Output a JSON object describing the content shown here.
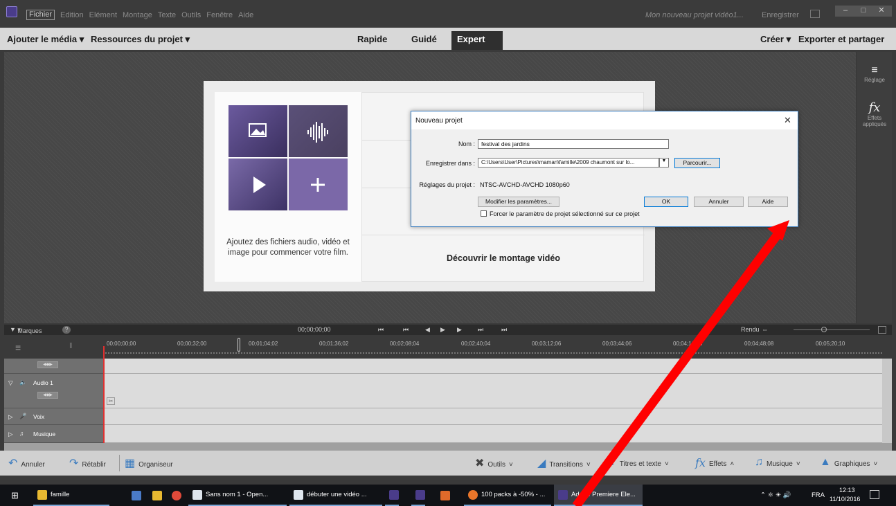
{
  "titlebar": {
    "menus": [
      "Fichier",
      "Edition",
      "Elément",
      "Montage",
      "Texte",
      "Outils",
      "Fenêtre",
      "Aide"
    ],
    "project_title": "Mon nouveau projet vidéo1...",
    "save_label": "Enregistrer",
    "win_min": "‒",
    "win_max": "□",
    "win_close": "✕"
  },
  "modebar": {
    "add_media": "Ajouter le média ▾",
    "project_resources": "Ressources du projet ▾",
    "tab_quick": "Rapide",
    "tab_guided": "Guidé",
    "tab_expert": "Expert",
    "create": "Créer ▾",
    "export_share": "Exporter et partager"
  },
  "rightpanel": {
    "adjust_label": "Réglage",
    "fx_label": "Effets appliqués"
  },
  "welcome": {
    "intro_text": "Ajoutez des fichiers audio, vidéo et image pour commencer votre film.",
    "discover": "Découvrir le montage vidéo"
  },
  "dialog": {
    "title": "Nouveau projet",
    "close": "✕",
    "name_label": "Nom :",
    "name_value": "festival des jardins",
    "save_in_label": "Enregistrer dans :",
    "save_in_value": "C:\\Users\\User\\Pictures\\maman\\famille\\2009 chaumont sur lo...",
    "browse": "Parcourir...",
    "settings_label": "Réglages du projet :",
    "settings_value": "NTSC-AVCHD-AVCHD 1080p60",
    "modify": "Modifier les paramètres...",
    "ok": "OK",
    "cancel": "Annuler",
    "help": "Aide",
    "force_label": "Forcer le paramètre de projet sélectionné sur ce projet"
  },
  "timeline": {
    "markers": "Marques",
    "timecode": "00;00;00;00",
    "render": "Rendu",
    "ruler_ticks": [
      "00;00;00;00",
      "00;00;32;00",
      "00;01;04;02",
      "00;01;36;02",
      "00;02;08;04",
      "00;02;40;04",
      "00;03;12;06",
      "00;03;44;06",
      "00;04;16;08",
      "00;04;48;08",
      "00;05;20;10"
    ],
    "tracks": [
      {
        "label": ""
      },
      {
        "label": "Audio 1"
      },
      {
        "label": "Voix"
      },
      {
        "label": "Musique"
      }
    ]
  },
  "actionbar": {
    "undo": "Annuler",
    "redo": "Rétablir",
    "organizer": "Organiseur",
    "tools": "Outils",
    "transitions": "Transitions",
    "titles": "Titres et texte",
    "effects": "Effets",
    "music": "Musique",
    "graphics": "Graphiques"
  },
  "taskbar": {
    "folder": "famille",
    "app1": "Sans nom 1 - Open...",
    "app2": "débuter une vidéo ...",
    "firefox": "100 packs à -50% - ...",
    "premiere": "Adobe Premiere Ele...",
    "lang": "FRA",
    "time": "12:13",
    "date": "11/10/2016"
  },
  "colors": {
    "accent": "#3a7bbf",
    "arrow": "#ff0000",
    "dialog_border": "#3c7fc0"
  }
}
